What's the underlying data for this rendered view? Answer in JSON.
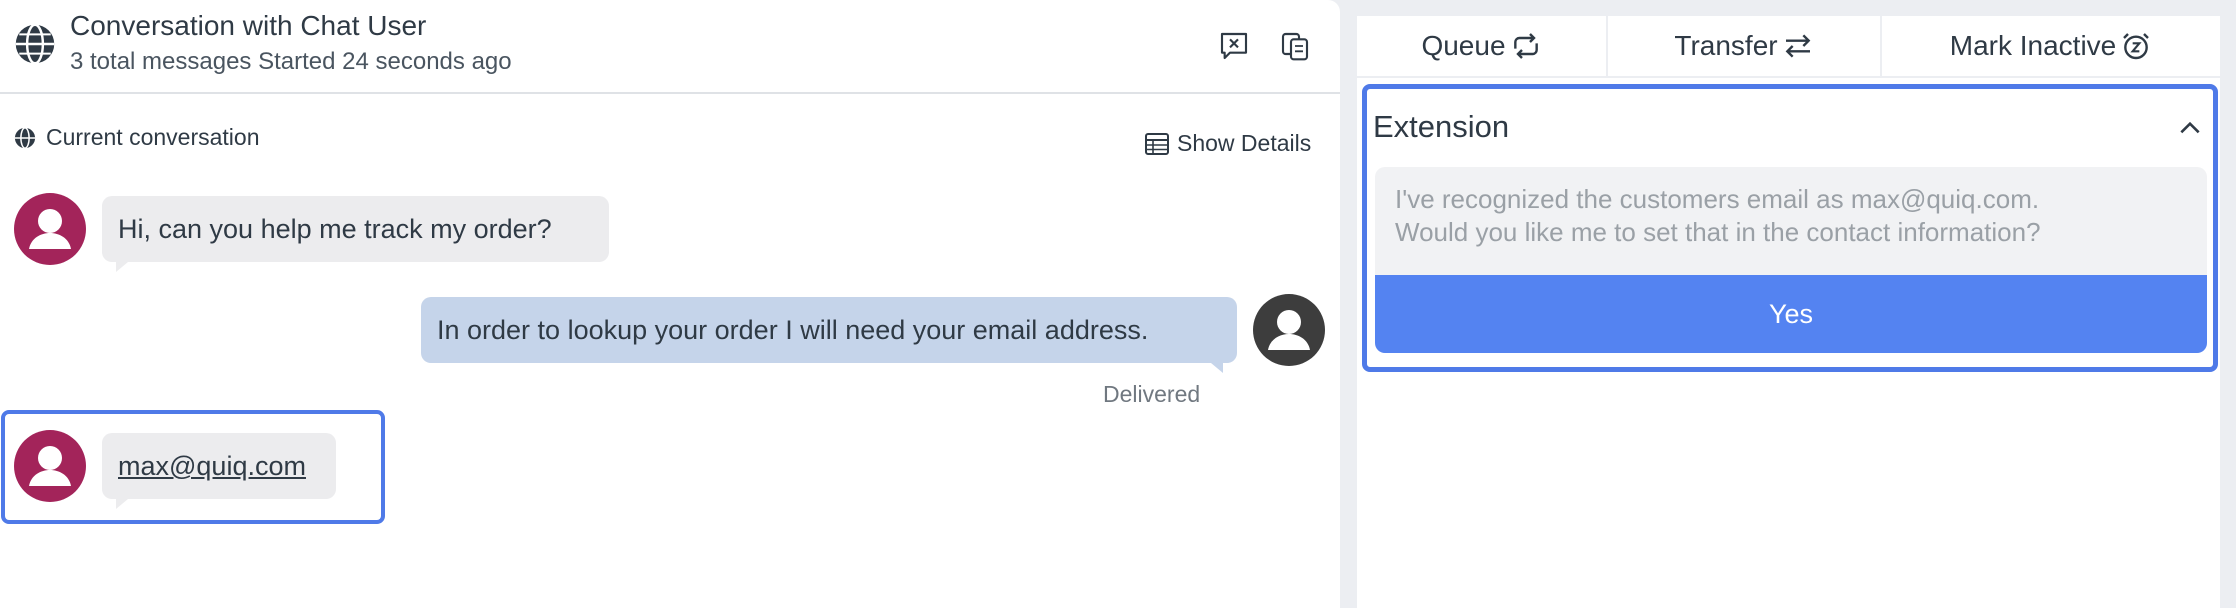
{
  "conversation": {
    "title": "Conversation with Chat User",
    "subtitle": "3 total messages Started 24 seconds ago",
    "section_label": "Current conversation",
    "show_details_label": "Show Details",
    "header_icons": [
      "globe-icon",
      "end-chat-icon",
      "copy-icon"
    ]
  },
  "messages": [
    {
      "sender": "customer",
      "text": "Hi, can you help me track my order?"
    },
    {
      "sender": "agent",
      "text": "In order to lookup your order I will need your email address.",
      "status": "Delivered"
    },
    {
      "sender": "customer",
      "text": "max@quiq.com"
    }
  ],
  "actions": [
    {
      "label": "Queue",
      "icon": "requeue-icon"
    },
    {
      "label": "Transfer",
      "icon": "transfer-icon"
    },
    {
      "label": "Mark Inactive",
      "icon": "alarm-snooze-icon"
    }
  ],
  "extension": {
    "title": "Extension",
    "message_line1": "I've recognized the customers email as max@quiq.com.",
    "message_line2": "Would you like me to set that in the contact information?",
    "confirm_label": "Yes"
  },
  "colors": {
    "highlight": "#4f7ae8",
    "primary_button": "#5483f1",
    "customer_avatar": "#a3245a",
    "agent_avatar": "#3d3d3d",
    "outgoing_bubble": "#c5d4ea",
    "incoming_bubble": "#ececee"
  }
}
